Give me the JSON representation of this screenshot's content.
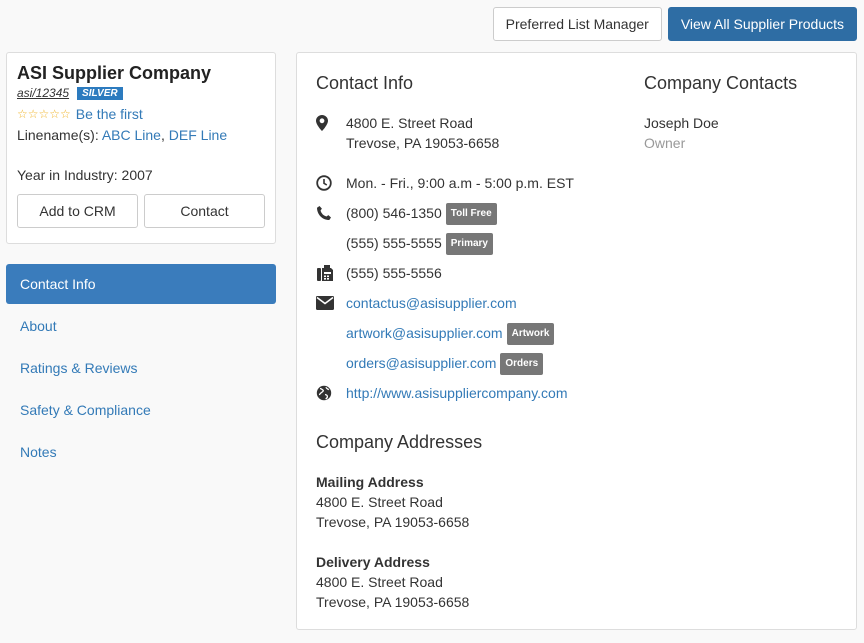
{
  "toolbar": {
    "preferred_list_label": "Preferred List Manager",
    "view_all_label": "View All Supplier Products"
  },
  "company": {
    "name": "ASI Supplier Company",
    "asi_number": "asi/12345",
    "tier_badge": "SILVER",
    "stars": "☆☆☆☆☆",
    "rating_link": "Be the first",
    "linename_label": "Linename(s):",
    "linenames": [
      "ABC Line",
      "DEF Line"
    ],
    "linename_sep": ",",
    "year_in_industry": "Year in Industry: 2007",
    "add_to_crm_label": "Add to CRM",
    "contact_label": "Contact"
  },
  "nav": {
    "items": [
      "Contact Info",
      "About",
      "Ratings & Reviews",
      "Safety & Compliance",
      "Notes"
    ],
    "active_index": 0
  },
  "contact_info": {
    "title": "Contact Info",
    "address_line1": "4800 E. Street Road",
    "address_line2": "Trevose, PA 19053-6658",
    "hours": "Mon. - Fri., 9:00 a.m - 5:00 p.m. EST",
    "phones": [
      {
        "number": "(800) 546-1350",
        "tag": "Toll Free"
      },
      {
        "number": "(555) 555-5555",
        "tag": "Primary"
      }
    ],
    "fax": "(555) 555-5556",
    "emails": [
      {
        "address": "contactus@asisupplier.com",
        "tag": ""
      },
      {
        "address": "artwork@asisupplier.com",
        "tag": "Artwork"
      },
      {
        "address": "orders@asisupplier.com",
        "tag": "Orders"
      }
    ],
    "website": "http://www.asisuppliercompany.com"
  },
  "company_contacts": {
    "title": "Company Contacts",
    "name": "Joseph Doe",
    "role": "Owner"
  },
  "addresses": {
    "title": "Company Addresses",
    "mailing": {
      "label": "Mailing Address",
      "line1": "4800 E. Street Road",
      "line2": "Trevose, PA 19053-6658"
    },
    "delivery": {
      "label": "Delivery Address",
      "line1": "4800 E. Street Road",
      "line2": "Trevose, PA 19053-6658"
    }
  },
  "icons": {
    "address": "map-marker-icon",
    "hours": "clock-icon",
    "phone": "phone-icon",
    "fax": "fax-icon",
    "email": "envelope-icon",
    "website": "globe-icon"
  },
  "colors": {
    "primary": "#2e6da4",
    "nav_active": "#3a7cbc",
    "link": "#337ab7",
    "badge_silver": "#2c7bbf",
    "tag_gray": "#777777"
  }
}
